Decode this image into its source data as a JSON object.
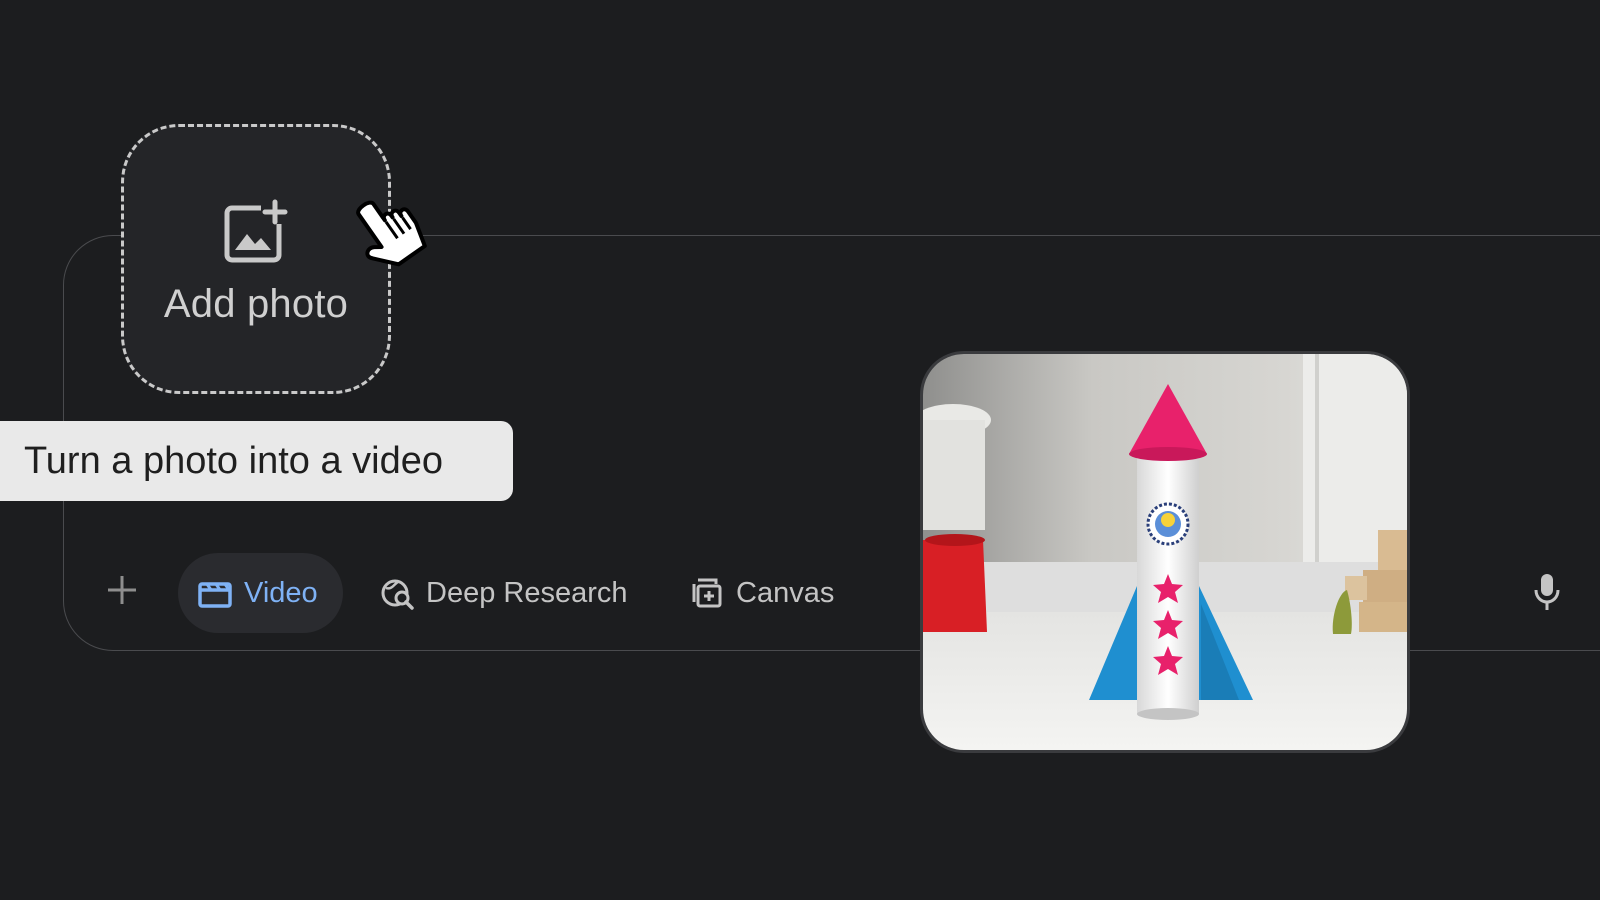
{
  "add_photo": {
    "label": "Add photo",
    "icon": "add-photo-icon"
  },
  "tooltip": {
    "text": "Turn a photo into a video"
  },
  "toolbar": {
    "plus_icon": "plus-icon",
    "tools": [
      {
        "label": "Video",
        "icon": "clapperboard-icon",
        "active": true
      },
      {
        "label": "Deep Research",
        "icon": "globe-search-icon",
        "active": false
      },
      {
        "label": "Canvas",
        "icon": "canvas-icon",
        "active": false
      }
    ],
    "mic_icon": "microphone-icon"
  },
  "colors": {
    "background": "#1c1d1f",
    "accent": "#7fb2f5",
    "tooltip_bg": "#e9e9e9"
  }
}
